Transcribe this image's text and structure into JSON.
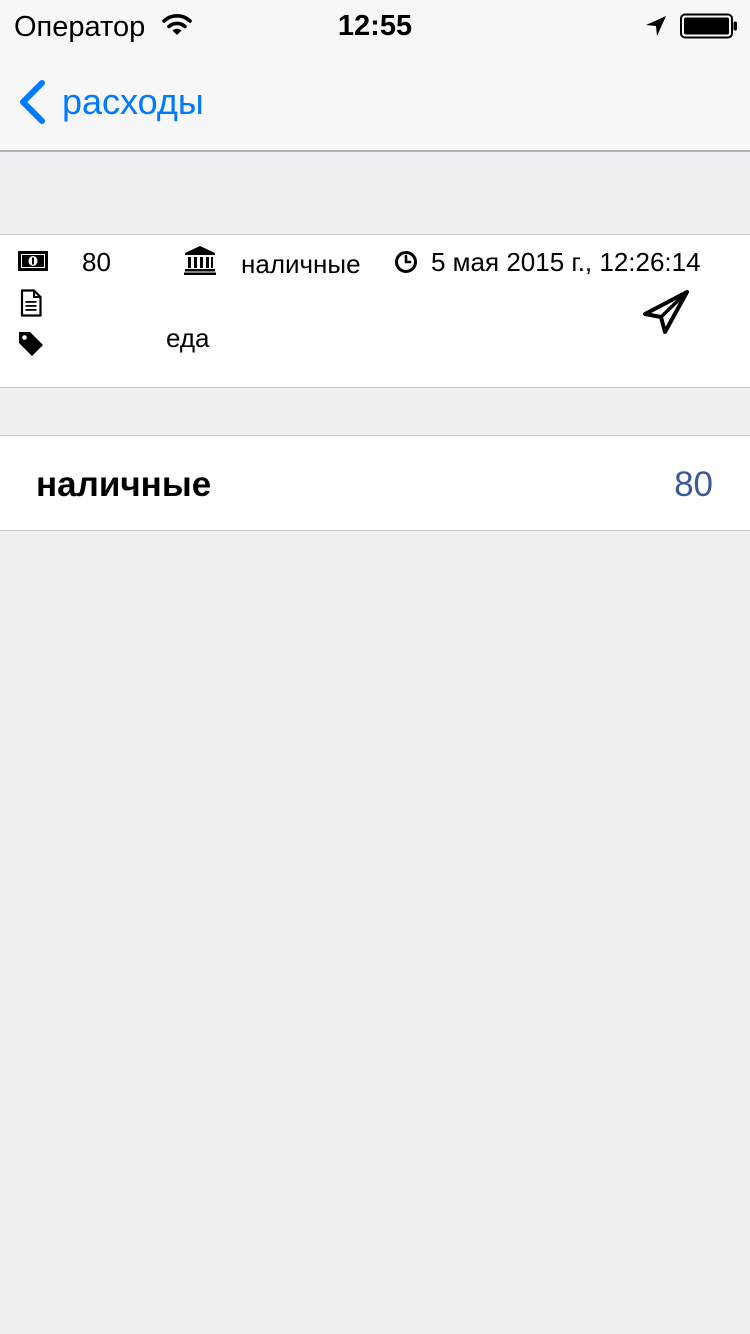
{
  "status_bar": {
    "carrier": "Оператор",
    "time": "12:55",
    "icons": [
      "wifi-icon",
      "location-arrow-icon",
      "battery-icon"
    ]
  },
  "nav": {
    "back_label": "расходы",
    "accent_color": "#007aff"
  },
  "transaction": {
    "amount": "80",
    "account": "наличные",
    "datetime": "5 мая 2015 г., 12:26:14",
    "note": "",
    "category": "еда",
    "icons": [
      "money-icon",
      "bank-icon",
      "clock-icon",
      "document-icon",
      "tag-icon",
      "paper-plane-icon"
    ]
  },
  "account_summary": {
    "name": "наличные",
    "value": "80",
    "value_color": "#3b5998"
  }
}
